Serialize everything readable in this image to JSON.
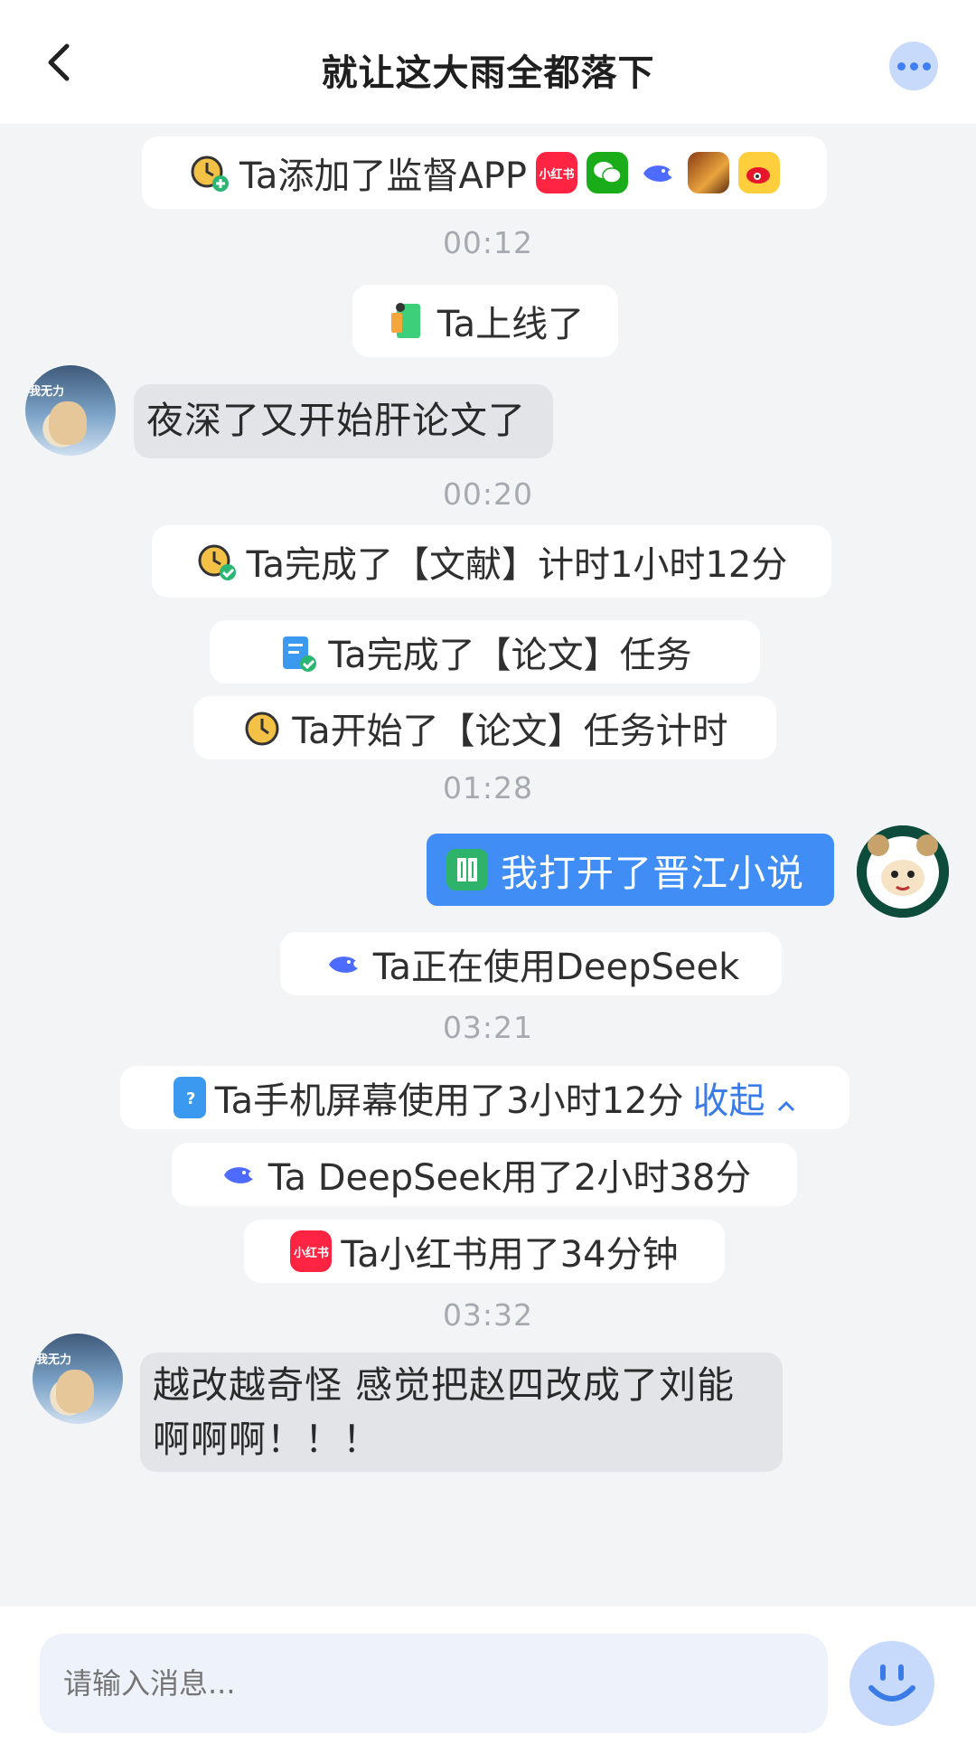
{
  "header": {
    "title": "就让这大雨全都落下"
  },
  "messages": {
    "supervise": {
      "text": "Ta添加了监督APP",
      "apps": [
        "小红书",
        "WeChat",
        "DeepSeek",
        "王者荣耀",
        "微博"
      ]
    },
    "time1": "00:12",
    "online": "Ta上线了",
    "msg1": "夜深了又开始肝论文了",
    "time2": "00:20",
    "done_lit": "Ta完成了【文献】计时1小时12分",
    "done_task": "Ta完成了【论文】任务",
    "start_task": "Ta开始了【论文】任务计时",
    "time3": "01:28",
    "my_msg": "我打开了晋江小说",
    "using_ds": "Ta正在使用DeepSeek",
    "time4": "03:21",
    "screen_time": "Ta手机屏幕使用了3小时12分",
    "collapse": "收起",
    "ds_time": "Ta DeepSeek用了2小时38分",
    "xhs_time": "Ta小红书用了34分钟",
    "time5": "03:32",
    "msg2_line1": "越改越奇怪 感觉把赵四改成了刘能",
    "msg2_line2": "啊啊啊！！！",
    "avatar_tag": "我无力"
  },
  "input": {
    "placeholder": "请输入消息..."
  },
  "icons": {
    "xhs_label": "小红书"
  },
  "colors": {
    "accent": "#3f8df5",
    "background": "#f3f4f6",
    "link": "#3b7be8"
  }
}
